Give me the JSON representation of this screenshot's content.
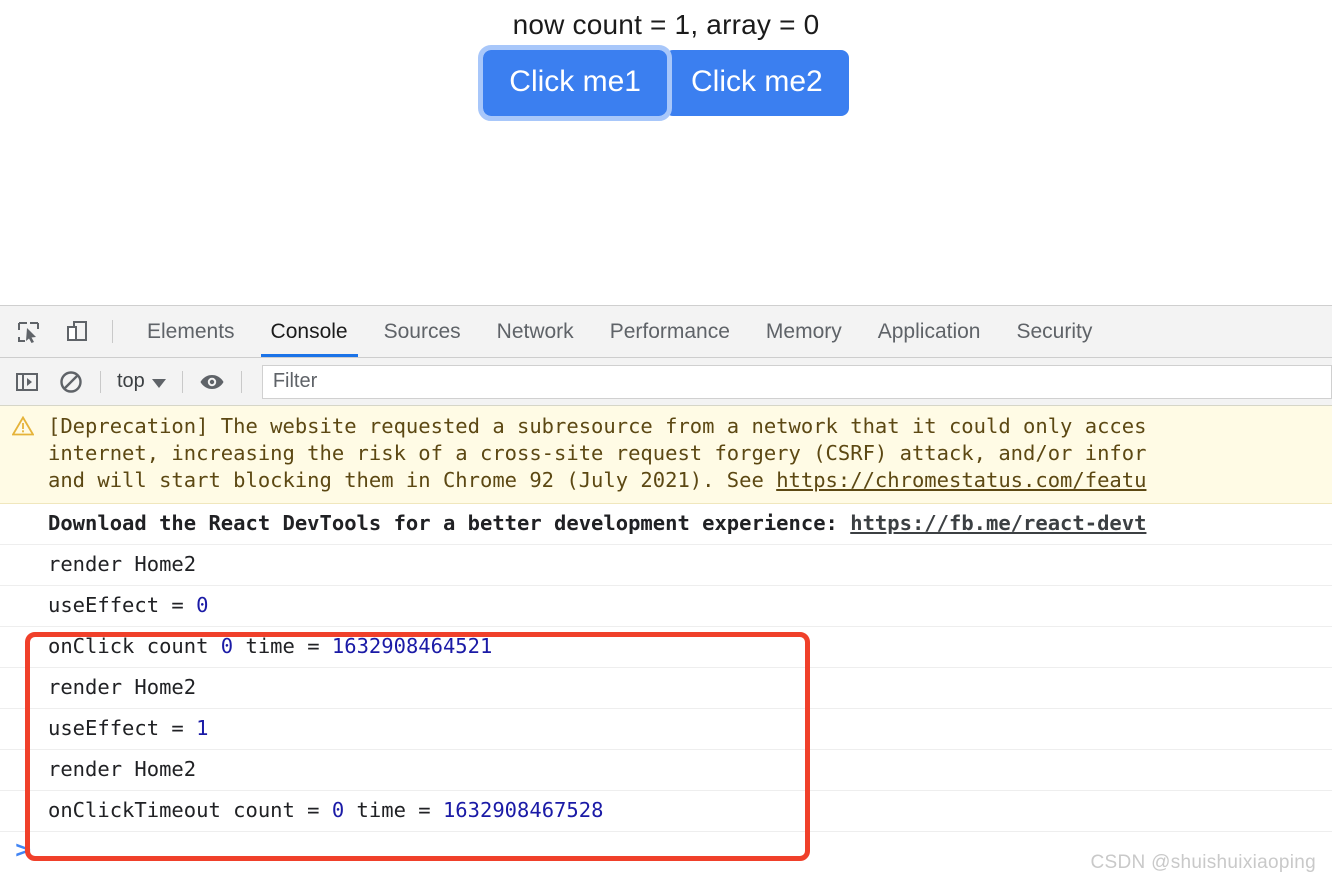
{
  "page": {
    "status_text": "now count = 1, array = 0",
    "buttons": [
      {
        "label": "Click me1",
        "focused": true
      },
      {
        "label": "Click me2",
        "focused": false
      }
    ]
  },
  "devtools": {
    "tabs": [
      {
        "label": "Elements",
        "active": false
      },
      {
        "label": "Console",
        "active": true
      },
      {
        "label": "Sources",
        "active": false
      },
      {
        "label": "Network",
        "active": false
      },
      {
        "label": "Performance",
        "active": false
      },
      {
        "label": "Memory",
        "active": false
      },
      {
        "label": "Application",
        "active": false
      },
      {
        "label": "Security",
        "active": false
      }
    ],
    "toolbar": {
      "inspect_icon": "inspect-element-icon",
      "device_icon": "device-toolbar-icon",
      "sidebar_icon": "console-sidebar-icon",
      "clear_icon": "clear-console-icon",
      "eye_icon": "live-expression-icon",
      "context": "top",
      "filter_placeholder": "Filter",
      "filter_value": ""
    },
    "console": {
      "warning": {
        "icon": "warning-triangle-icon",
        "lines": [
          "[Deprecation] The website requested a subresource from a network that it could only acces",
          "internet, increasing the risk of a cross-site request forgery (CSRF) attack, and/or infor",
          "and will start blocking them in Chrome 92 (July 2021). See "
        ],
        "link": "https://chromestatus.com/featu"
      },
      "react_devtools": {
        "text": "Download the React DevTools for a better development experience: ",
        "link": "https://fb.me/react-devt"
      },
      "logs": [
        {
          "text": "render Home2",
          "num": "",
          "tail": "",
          "num2": ""
        },
        {
          "text": "useEffect = ",
          "num": "0",
          "tail": "",
          "num2": ""
        },
        {
          "text": "onClick count ",
          "num": "0",
          "tail": " time = ",
          "num2": "1632908464521"
        },
        {
          "text": "render Home2",
          "num": "",
          "tail": "",
          "num2": ""
        },
        {
          "text": "useEffect = ",
          "num": "1",
          "tail": "",
          "num2": ""
        },
        {
          "text": "render Home2",
          "num": "",
          "tail": "",
          "num2": ""
        },
        {
          "text": "onClickTimeout count = ",
          "num": "0",
          "tail": " time = ",
          "num2": "1632908467528"
        }
      ],
      "prompt": ">"
    }
  },
  "annotation": {
    "highlight_color": "#f0402a"
  },
  "watermark": "CSDN @shuishuixiaoping"
}
